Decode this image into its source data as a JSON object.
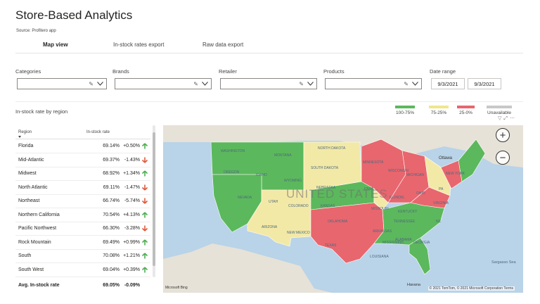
{
  "page": {
    "title": "Store-Based Analytics",
    "source": "Source: Profitero app"
  },
  "tabs": [
    {
      "label": "Map view",
      "active": true
    },
    {
      "label": "In-stock rates export",
      "active": false
    },
    {
      "label": "Raw data export",
      "active": false
    }
  ],
  "filters": {
    "categories": {
      "label": "Categories",
      "value": ""
    },
    "brands": {
      "label": "Brands",
      "value": ""
    },
    "retailer": {
      "label": "Retailer",
      "value": ""
    },
    "products": {
      "label": "Products",
      "value": ""
    },
    "date_range": {
      "label": "Date range",
      "start": "9/3/2021",
      "end": "9/3/2021"
    }
  },
  "section": {
    "title": "In-stock rate by region"
  },
  "legend": [
    {
      "label": "100-75%",
      "color": "#5cb85c"
    },
    {
      "label": "75-25%",
      "color": "#f0e68c"
    },
    {
      "label": "25-0%",
      "color": "#e8666e"
    },
    {
      "label": "Unavailable",
      "color": "#c8c8c8"
    }
  ],
  "table": {
    "headers": {
      "region": "Region",
      "rate": "In-stock rate"
    },
    "rows": [
      {
        "region": "Florida",
        "rate": "69.14%",
        "change": "+0.50%",
        "dir": "up"
      },
      {
        "region": "Mid-Atlantic",
        "rate": "69.37%",
        "change": "-1.43%",
        "dir": "down"
      },
      {
        "region": "Midwest",
        "rate": "68.92%",
        "change": "+1.34%",
        "dir": "up"
      },
      {
        "region": "North Atlantic",
        "rate": "69.11%",
        "change": "-1.47%",
        "dir": "down"
      },
      {
        "region": "Northeast",
        "rate": "66.74%",
        "change": "-5.74%",
        "dir": "down"
      },
      {
        "region": "Northern California",
        "rate": "70.54%",
        "change": "+4.13%",
        "dir": "up"
      },
      {
        "region": "Pacific Northwest",
        "rate": "66.30%",
        "change": "-3.28%",
        "dir": "down"
      },
      {
        "region": "Rock Mountain",
        "rate": "69.49%",
        "change": "+0.99%",
        "dir": "up"
      },
      {
        "region": "South",
        "rate": "70.08%",
        "change": "+1.21%",
        "dir": "up"
      },
      {
        "region": "South West",
        "rate": "69.04%",
        "change": "+0.39%",
        "dir": "up"
      }
    ],
    "total": {
      "label": "Avg. In-stock rate",
      "rate": "69.05%",
      "change": "-0.09%"
    }
  },
  "colors": {
    "up": "#4caf50",
    "down": "#e05a3a"
  },
  "map": {
    "country_label": "UNITED STATES",
    "labels": {
      "washington": "WASHINGTON",
      "oregon": "OREGON",
      "idaho": "IDAHO",
      "montana": "MONTANA",
      "wyoming": "WYOMING",
      "nevada": "NEVADA",
      "utah": "UTAH",
      "colorado": "COLORADO",
      "arizona": "ARIZONA",
      "new_mexico": "NEW MEXICO",
      "north_dakota": "NORTH DAKOTA",
      "south_dakota": "SOUTH DAKOTA",
      "nebraska": "NEBRASKA",
      "kansas": "KANSAS",
      "oklahoma": "OKLAHOMA",
      "texas": "TEXAS",
      "minnesota": "MINNESOTA",
      "iowa": "IOWA",
      "missouri": "MISSOURI",
      "arkansas": "ARKANSAS",
      "louisiana": "LOUISIANA",
      "wisconsin": "WISCONSIN",
      "illinois": "ILLINOIS",
      "michigan": "MICHIGAN",
      "ohio": "OHIO",
      "kentucky": "KENTUCKY",
      "tennessee": "TENNESSEE",
      "mississippi": "MISSISSIPPI",
      "alabama": "ALABAMA",
      "georgia": "GEORGIA",
      "pennsylvania": "PA",
      "virginia": "VIRGINIA",
      "north_carolina": "NC",
      "new_york": "NEW YORK",
      "ottawa": "Ottawa",
      "sargasso": "Sargasso Sea",
      "havana": "Havana"
    },
    "bing": "Microsoft Bing",
    "attribution": "© 2021 TomTom, © 2021 Microsoft Corporation  Terms"
  }
}
